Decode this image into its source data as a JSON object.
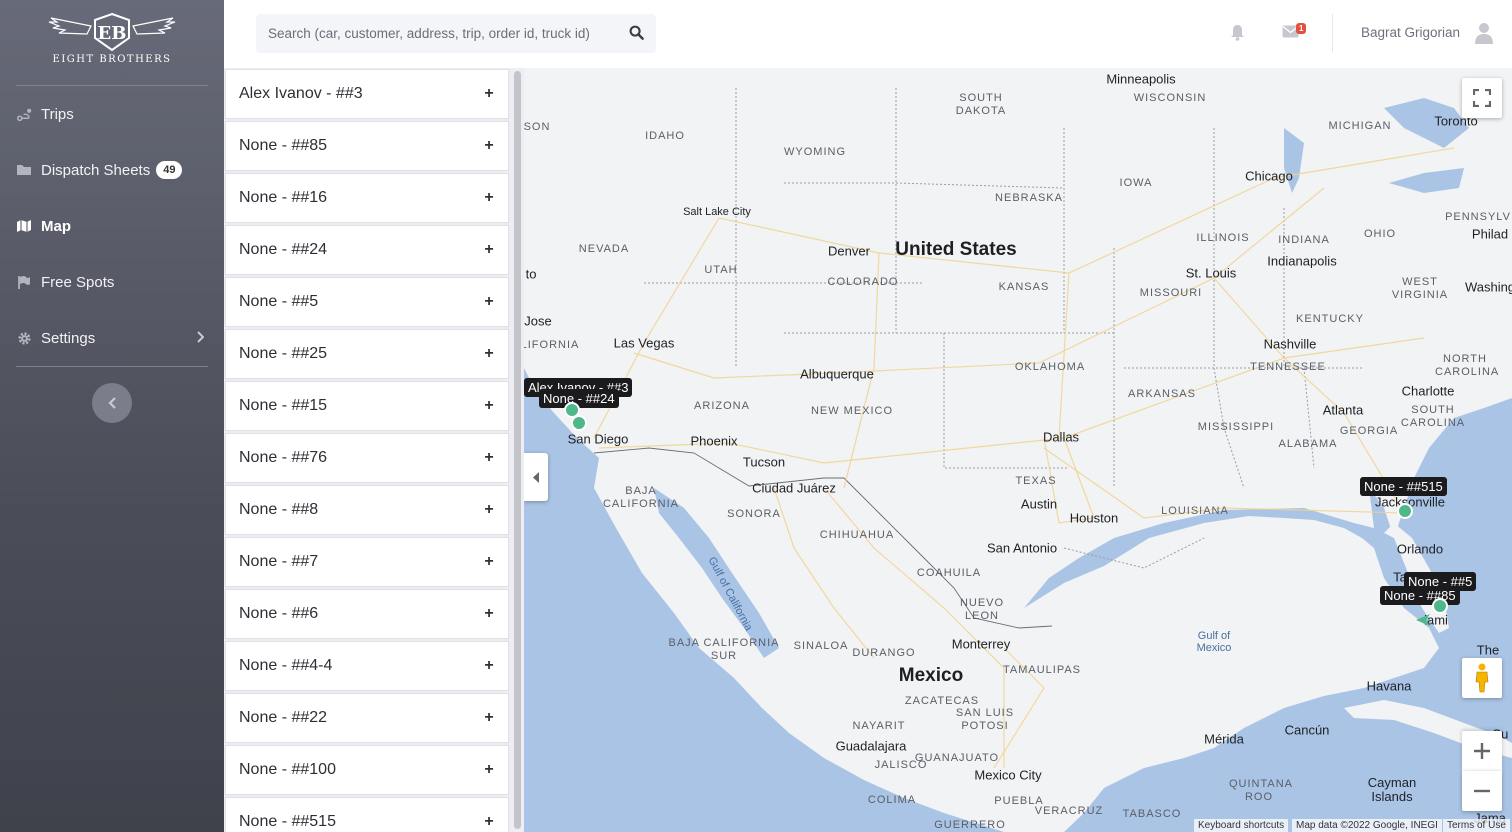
{
  "brand": {
    "logo_text": "EIGHT BROTHERS",
    "monogram": "EB"
  },
  "sidebar": {
    "items": [
      {
        "label": "Trips",
        "icon": "route-icon"
      },
      {
        "label": "Dispatch Sheets",
        "icon": "folder-icon",
        "badge": "49"
      },
      {
        "label": "Map",
        "icon": "map-icon",
        "active": true
      },
      {
        "label": "Free Spots",
        "icon": "flag-icon"
      },
      {
        "label": "Settings",
        "icon": "gear-icon",
        "has_submenu": true
      }
    ]
  },
  "search": {
    "placeholder": "Search (car, customer, address, trip, order id, truck id)"
  },
  "header": {
    "user_name": "Bagrat Grigorian",
    "mail_count": "1"
  },
  "trips": [
    {
      "name": "Alex Ivanov - ##3"
    },
    {
      "name": "None - ##85"
    },
    {
      "name": "None - ##16"
    },
    {
      "name": "None - ##24"
    },
    {
      "name": "None - ##5"
    },
    {
      "name": "None - ##25"
    },
    {
      "name": "None - ##15"
    },
    {
      "name": "None - ##76"
    },
    {
      "name": "None - ##8"
    },
    {
      "name": "None - ##7"
    },
    {
      "name": "None - ##6"
    },
    {
      "name": "None - ##4-4"
    },
    {
      "name": "None - ##22"
    },
    {
      "name": "None - ##100"
    },
    {
      "name": "None - ##515"
    }
  ],
  "list_expand_symbol": "+",
  "map": {
    "markers": [
      {
        "label": "Alex Ivanov - ##3"
      },
      {
        "label": "None - ##24"
      },
      {
        "label": "None - ##515"
      },
      {
        "label": "None - ##5"
      },
      {
        "label": "None - ##85"
      }
    ],
    "labels": {
      "countries": [
        "United States",
        "Mexico"
      ],
      "states": [
        "SOUTH DAKOTA",
        "WISCONSIN",
        "MICHIGAN",
        "IDAHO",
        "WYOMING",
        "IOWA",
        "NEBRASKA",
        "NEVADA",
        "UTAH",
        "COLORADO",
        "KANSAS",
        "ILLINOIS",
        "INDIANA",
        "OHIO",
        "MISSOURI",
        "WEST VIRGINIA",
        "KENTUCKY",
        "ARIZONA",
        "NEW MEXICO",
        "OKLAHOMA",
        "TENNESSEE",
        "NORTH CAROLINA",
        "ARKANSAS",
        "SOUTH CAROLINA",
        "MISSISSIPPI",
        "ALABAMA",
        "GEORGIA",
        "TEXAS",
        "LOUISIANA",
        "LIFORNIA",
        "BAJA CALIFORNIA",
        "SONORA",
        "CHIHUAHUA",
        "COAHUILA",
        "NUEVO LEON",
        "BAJA CALIFORNIA SUR",
        "SINALOA",
        "DURANGO",
        "TAMAULIPAS",
        "ZACATECAS",
        "SAN LUIS POTOSI",
        "NAYARIT",
        "GUANAJUATO",
        "JALISCO",
        "COLIMA",
        "VERACRUZ",
        "TABASCO",
        "GUERRERO",
        "PUEBLA",
        "PENNSYLV",
        "QUINTANA ROO",
        "SON"
      ],
      "cities": [
        "Minneapolis",
        "Toronto",
        "Chicago",
        "Salt Lake City",
        "Denver",
        "St. Louis",
        "Indianapolis",
        "Philad",
        "Washing",
        "Las Vegas",
        "Albuquerque",
        "Nashville",
        "Charlotte",
        "Atlanta",
        "San Diego",
        "Phoenix",
        "Tucson",
        "Dallas",
        "Ciudad Juárez",
        "Austin",
        "Houston",
        "San Antonio",
        "Jacksonville",
        "Orlando",
        "Ta",
        "iami",
        "Monterrey",
        "Guadalajara",
        "Mexico City",
        "Havana",
        "Mérida",
        "Cancún",
        "Cayman Islands",
        "Jose",
        "to",
        "The",
        "Cu",
        "Jama"
      ],
      "water": [
        "Gulf of Mexico",
        "Gulf of California"
      ]
    },
    "attribution": {
      "shortcuts": "Keyboard shortcuts",
      "data": "Map data ©2022 Google, INEGI",
      "terms": "Terms of Use"
    }
  },
  "colors": {
    "sidebar_top": "#676a78",
    "sidebar_bottom": "#3f414b",
    "marker": "#4fb88a",
    "water": "#aac4e6",
    "land": "#f1f3f5"
  }
}
